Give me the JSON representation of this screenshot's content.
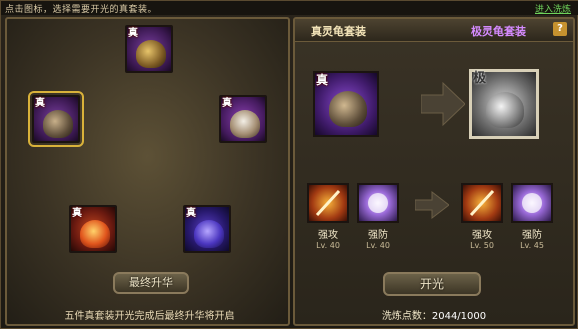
{
  "top": {
    "hint": "点击图标，选择需要开光的真套装。",
    "link": "进入洗炼"
  },
  "left": {
    "slots": [
      {
        "tag": "真",
        "theme": "gold-dragon"
      },
      {
        "tag": "真",
        "theme": "turtle",
        "selected": true
      },
      {
        "tag": "真",
        "theme": "tiger"
      },
      {
        "tag": "真",
        "theme": "phoenix"
      },
      {
        "tag": "真",
        "theme": "dragon"
      }
    ],
    "final_button": "最终升华",
    "tip": "五件真套装开光完成后最终升华将开启"
  },
  "right": {
    "title_left": "真灵龟套装",
    "title_right": "极灵龟套装",
    "help": "?",
    "from_tag": "真",
    "to_tag": "极",
    "skills_from": [
      {
        "label": "强攻",
        "level": "Lv. 40",
        "icon": "sword-icon"
      },
      {
        "label": "强防",
        "level": "Lv. 40",
        "icon": "shield-glow-icon"
      }
    ],
    "skills_to": [
      {
        "label": "强攻",
        "level": "Lv. 50",
        "icon": "sword-icon"
      },
      {
        "label": "强防",
        "level": "Lv. 45",
        "icon": "shield-glow-icon"
      }
    ],
    "open_button": "开光",
    "points_label": "洗炼点数：",
    "points_value": "2044/1000"
  },
  "colors": {
    "accent_gold": "#d9b23a",
    "link_green": "#6fd35b",
    "purple_title": "#d58bff"
  }
}
